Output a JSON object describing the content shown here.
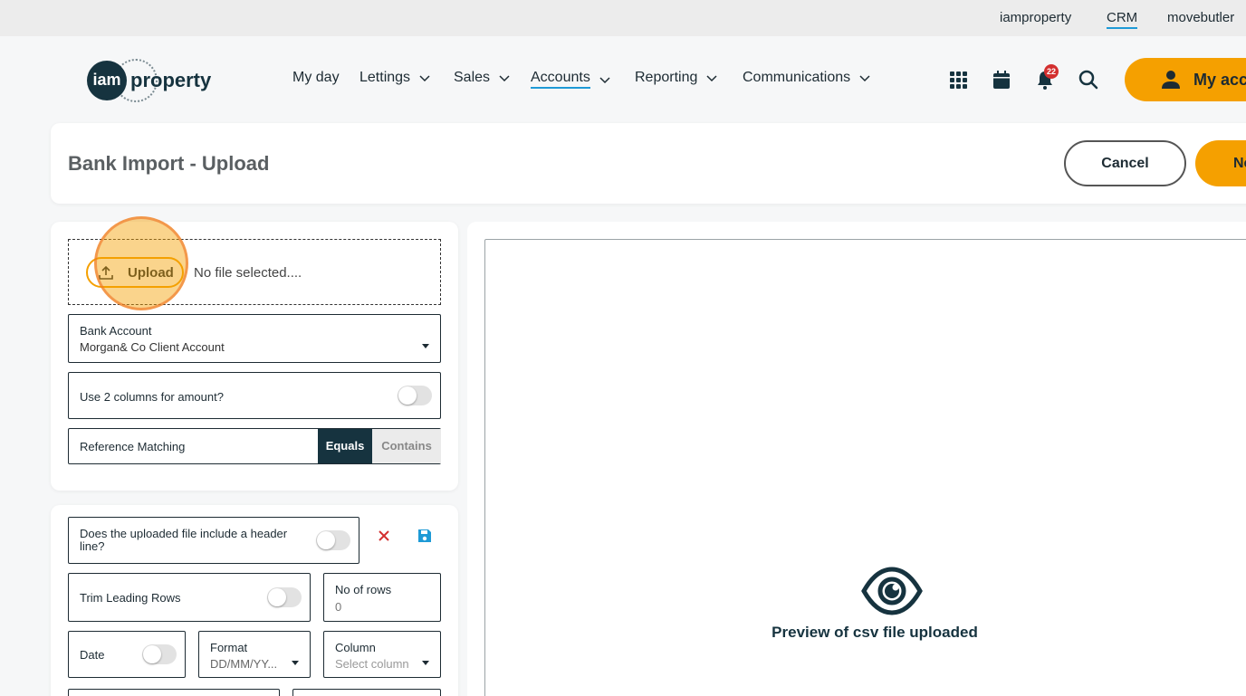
{
  "topbar": {
    "links": [
      "iamproperty",
      "CRM",
      "movebutler"
    ]
  },
  "logo": {
    "circle_text": "iam",
    "word": "property"
  },
  "nav": {
    "items": [
      "My day",
      "Lettings",
      "Sales",
      "Accounts",
      "Reporting",
      "Communications"
    ],
    "notification_count": "22",
    "account_label": "My acc"
  },
  "header": {
    "title": "Bank Import - Upload",
    "cancel_label": "Cancel",
    "next_label": "Ne"
  },
  "upload": {
    "button_label": "Upload",
    "status": "No file selected...."
  },
  "bank_account": {
    "label": "Bank Account",
    "value": "Morgan& Co Client Account"
  },
  "two_columns": {
    "label": "Use 2 columns for amount?"
  },
  "reference": {
    "label": "Reference Matching",
    "options": [
      "Equals",
      "Contains"
    ],
    "selected": "Equals"
  },
  "header_line": {
    "label": "Does the uploaded file include a header line?"
  },
  "trim": {
    "label": "Trim Leading Rows"
  },
  "rows": {
    "label": "No of rows",
    "value": "0"
  },
  "date": {
    "label": "Date"
  },
  "format": {
    "label": "Format",
    "value": "DD/MM/YY..."
  },
  "column": {
    "label": "Column",
    "placeholder": "Select column"
  },
  "preview": {
    "text": "Preview of csv file uploaded"
  },
  "colors": {
    "accent": "#f5a000",
    "navy": "#16333f",
    "link_underline": "#1e9ad6"
  },
  "icons": [
    "apps-grid-icon",
    "calendar-icon",
    "bell-icon",
    "search-icon",
    "user-icon",
    "upload-icon",
    "close-icon",
    "save-icon",
    "eye-icon",
    "chevron-down-icon"
  ]
}
